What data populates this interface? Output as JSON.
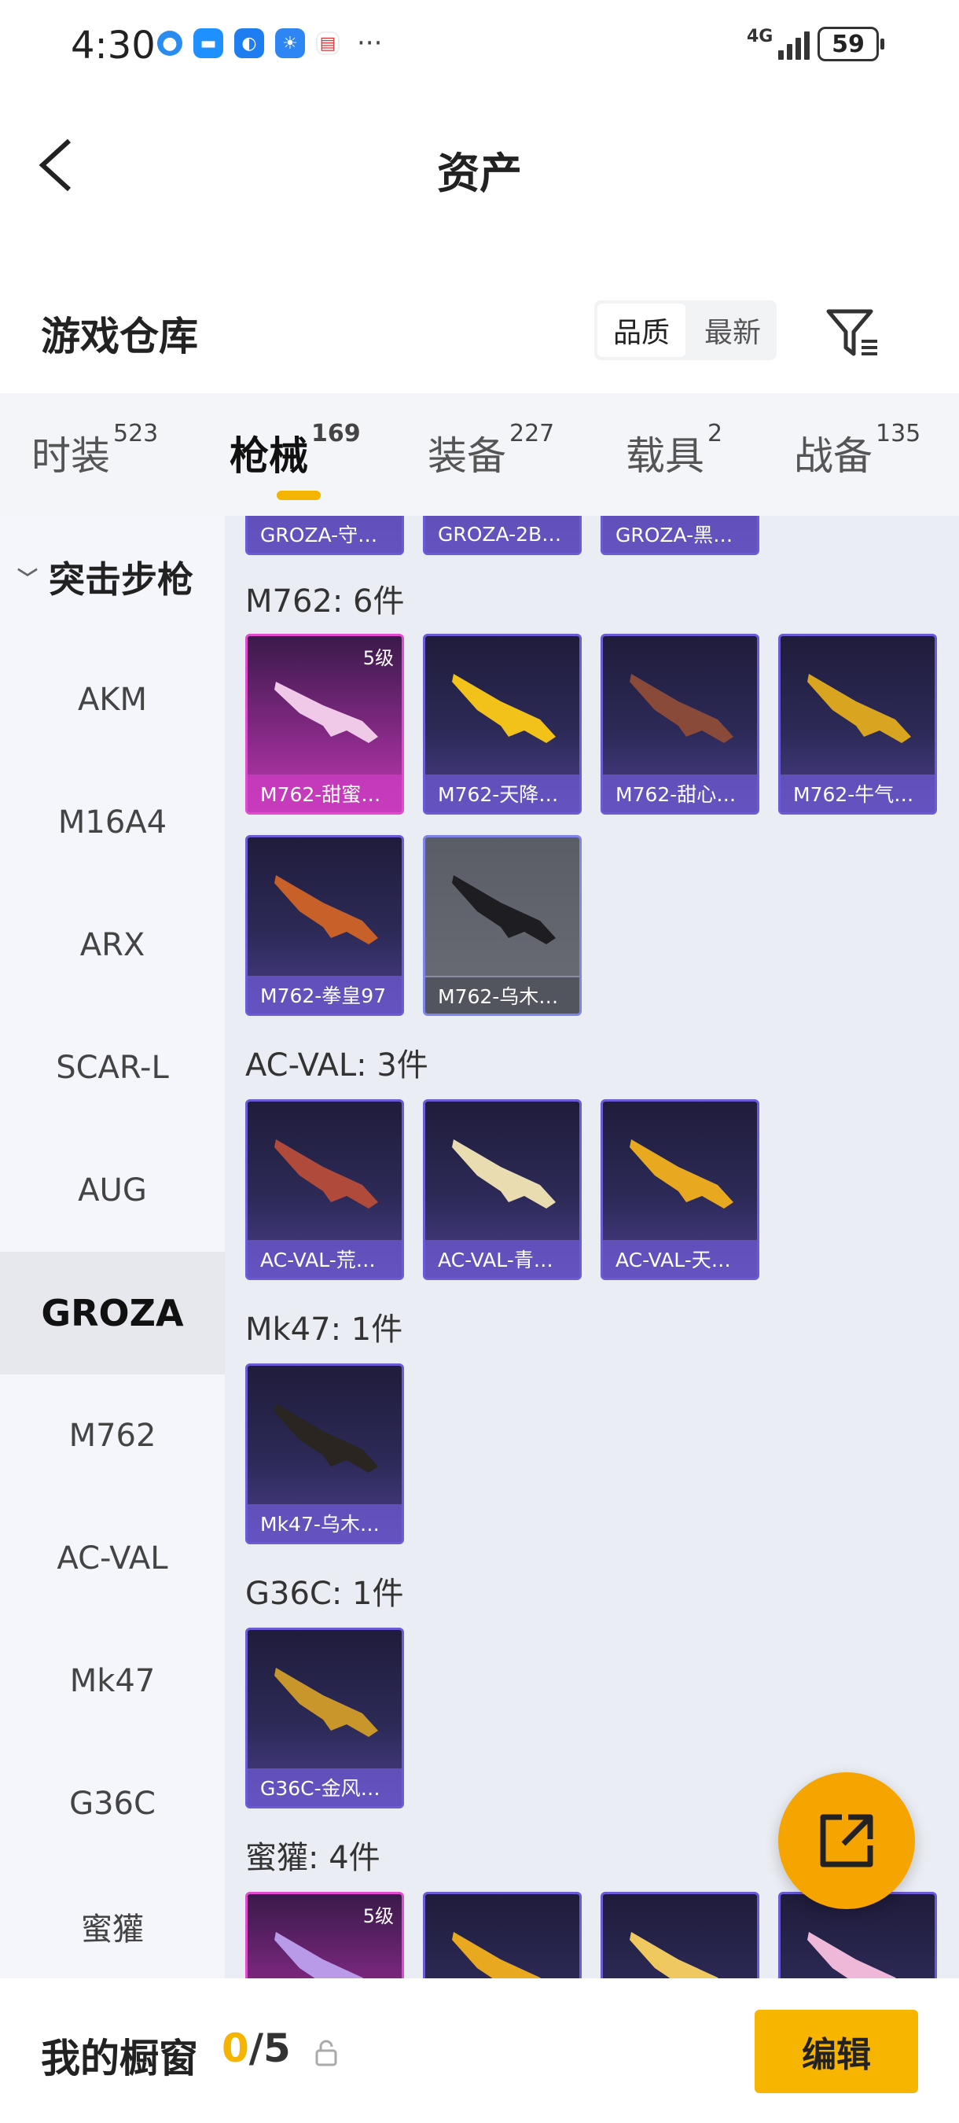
{
  "status_bar": {
    "time": "4:30",
    "network": "4G",
    "battery": "59",
    "icons": [
      "globe-icon",
      "message-icon",
      "bulb-icon",
      "weather-icon",
      "calendar-icon"
    ],
    "more": "···"
  },
  "header": {
    "title": "资产"
  },
  "warehouse": {
    "title": "游戏仓库",
    "sort": {
      "quality": "品质",
      "newest": "最新"
    }
  },
  "tabs": [
    {
      "label": "时装",
      "count": "523"
    },
    {
      "label": "枪械",
      "count": "169"
    },
    {
      "label": "装备",
      "count": "227"
    },
    {
      "label": "载具",
      "count": "2"
    },
    {
      "label": "战备",
      "count": "135"
    }
  ],
  "sidebar": {
    "category": "突击步枪",
    "items": [
      "AKM",
      "M16A4",
      "ARX",
      "SCAR-L",
      "AUG",
      "GROZA",
      "M762",
      "AC-VAL",
      "Mk47",
      "G36C",
      "蜜獾"
    ]
  },
  "groups": {
    "groza": {
      "items": [
        "GROZA-守…",
        "GROZA-2B…",
        "GROZA-黑…"
      ]
    },
    "m762": {
      "title": "M762: 6件",
      "items": [
        "M762-甜蜜…",
        "M762-天降…",
        "M762-甜心…",
        "M762-牛气…",
        "M762-拳皇97",
        "M762-乌木…"
      ],
      "level": "5级"
    },
    "acval": {
      "title": "AC-VAL: 3件",
      "items": [
        "AC-VAL-荒…",
        "AC-VAL-青…",
        "AC-VAL-天…"
      ]
    },
    "mk47": {
      "title": "Mk47: 1件",
      "items": [
        "Mk47-乌木…"
      ]
    },
    "g36c": {
      "title": "G36C: 1件",
      "items": [
        "G36C-金风…"
      ]
    },
    "honeybadger": {
      "title": "蜜獾: 4件",
      "level": "5级"
    }
  },
  "bottom": {
    "title": "我的橱窗",
    "count_current": "0",
    "count_total": "/5",
    "edit": "编辑"
  },
  "colors": {
    "accent": "#f5b400",
    "card_purple": "#6a5bd6",
    "card_pink": "#e04bcf"
  }
}
